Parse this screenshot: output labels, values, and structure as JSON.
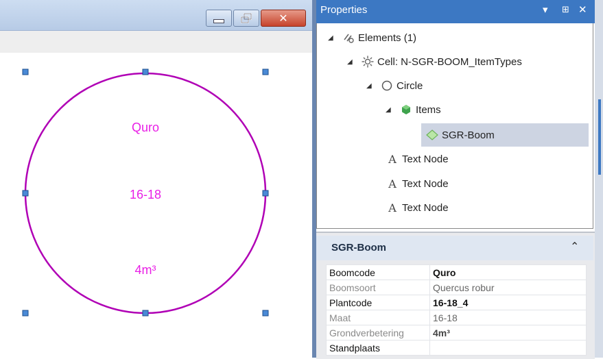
{
  "drawing": {
    "labels": [
      "Quro",
      "16-18",
      "4m³"
    ],
    "circle_color": "#b000b5",
    "text_color": "#e91ee6",
    "handle_color": "#4a8ad6"
  },
  "window_controls": {
    "minimize_icon": "minimize-icon",
    "restore_icon": "restore-icon",
    "close_glyph": "✕"
  },
  "properties_panel": {
    "title": "Properties",
    "titlebar_icons": {
      "dropdown": "▾",
      "pin": "⊞",
      "close": "✕"
    },
    "tree": [
      {
        "label": "Elements (1)",
        "icon": "elements-icon"
      },
      {
        "label": "Cell: N-SGR-BOOM_ItemTypes",
        "icon": "cell-icon"
      },
      {
        "label": "Circle",
        "icon": "circle-icon"
      },
      {
        "label": "Items",
        "icon": "items-icon"
      },
      {
        "label": "SGR-Boom",
        "icon": "item-diamond-icon"
      },
      {
        "label": "Text Node",
        "icon": "A"
      },
      {
        "label": "Text Node",
        "icon": "A"
      },
      {
        "label": "Text Node",
        "icon": "A"
      }
    ],
    "tree_expander": "◢",
    "section": {
      "title": "SGR-Boom",
      "collapse_glyph": "⌃",
      "rows": [
        {
          "key": "Boomcode",
          "value": "Quro"
        },
        {
          "key": "Boomsoort",
          "value": "Quercus robur"
        },
        {
          "key": "Plantcode",
          "value": "16-18_4"
        },
        {
          "key": "Maat",
          "value": "16-18"
        },
        {
          "key": "Grondverbetering",
          "value": "4m³"
        },
        {
          "key": "Standplaats",
          "value": ""
        }
      ]
    }
  }
}
